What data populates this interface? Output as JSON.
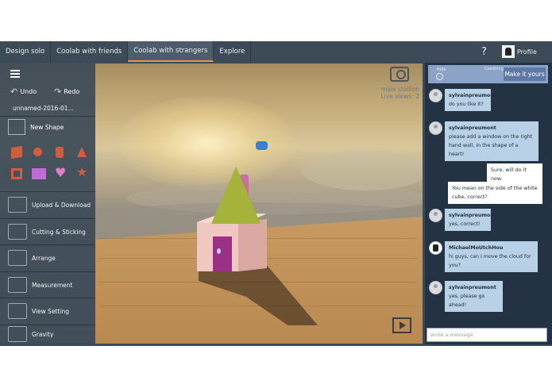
{
  "nav": {
    "tabs": [
      "Design solo",
      "Coolab with friends",
      "Coolab with strangers",
      "Explore"
    ],
    "active_tab": "Coolab with strangers",
    "help": "?",
    "profile_label": "Profile"
  },
  "viewport": {
    "stream_label": "male stallion",
    "live_views": "Live views: 2"
  },
  "toolbar": {
    "undo": "Undo",
    "redo": "Redo",
    "filename": "unnamed-2016-01...",
    "new_shape": "New Shape",
    "items": [
      {
        "label": "Upload & Download",
        "icon": "upload-download-icon"
      },
      {
        "label": "Cutting & Sticking",
        "icon": "cutting-icon"
      },
      {
        "label": "Arrange",
        "icon": "arrange-icon"
      },
      {
        "label": "Measurement",
        "icon": "ruler-icon"
      },
      {
        "label": "View Setting",
        "icon": "eye-icon"
      },
      {
        "label": "Gravity",
        "icon": "gravity-icon"
      }
    ],
    "shapes": [
      "cube",
      "sphere",
      "cylinder",
      "cone",
      "frame",
      "grid",
      "heart",
      "star"
    ]
  },
  "chat": {
    "hide": "Hide",
    "coediting": "Coediting",
    "make_yours": "Make it yours",
    "messages": [
      {
        "user": "sylvainpreumont",
        "text": "do you like it?",
        "own": false
      },
      {
        "user": "sylvainpreumont",
        "text": "please add a window on the right hand wall, in the shape of a heart!",
        "own": false
      },
      {
        "user": "",
        "text": "Sure, will do it now.",
        "own": true
      },
      {
        "user": "",
        "text": "You mean on the side of the white cube, correct?",
        "own": true
      },
      {
        "user": "sylvainpreumont",
        "text": "yes, correct!",
        "own": false
      },
      {
        "user": "MichaelMoUtchHou",
        "text": "hi guys, can I move the cloud for you?",
        "own": false
      },
      {
        "user": "sylvainpreumont",
        "text": "yes, please go ahead!",
        "own": false
      }
    ],
    "input_placeholder": "write a message"
  }
}
